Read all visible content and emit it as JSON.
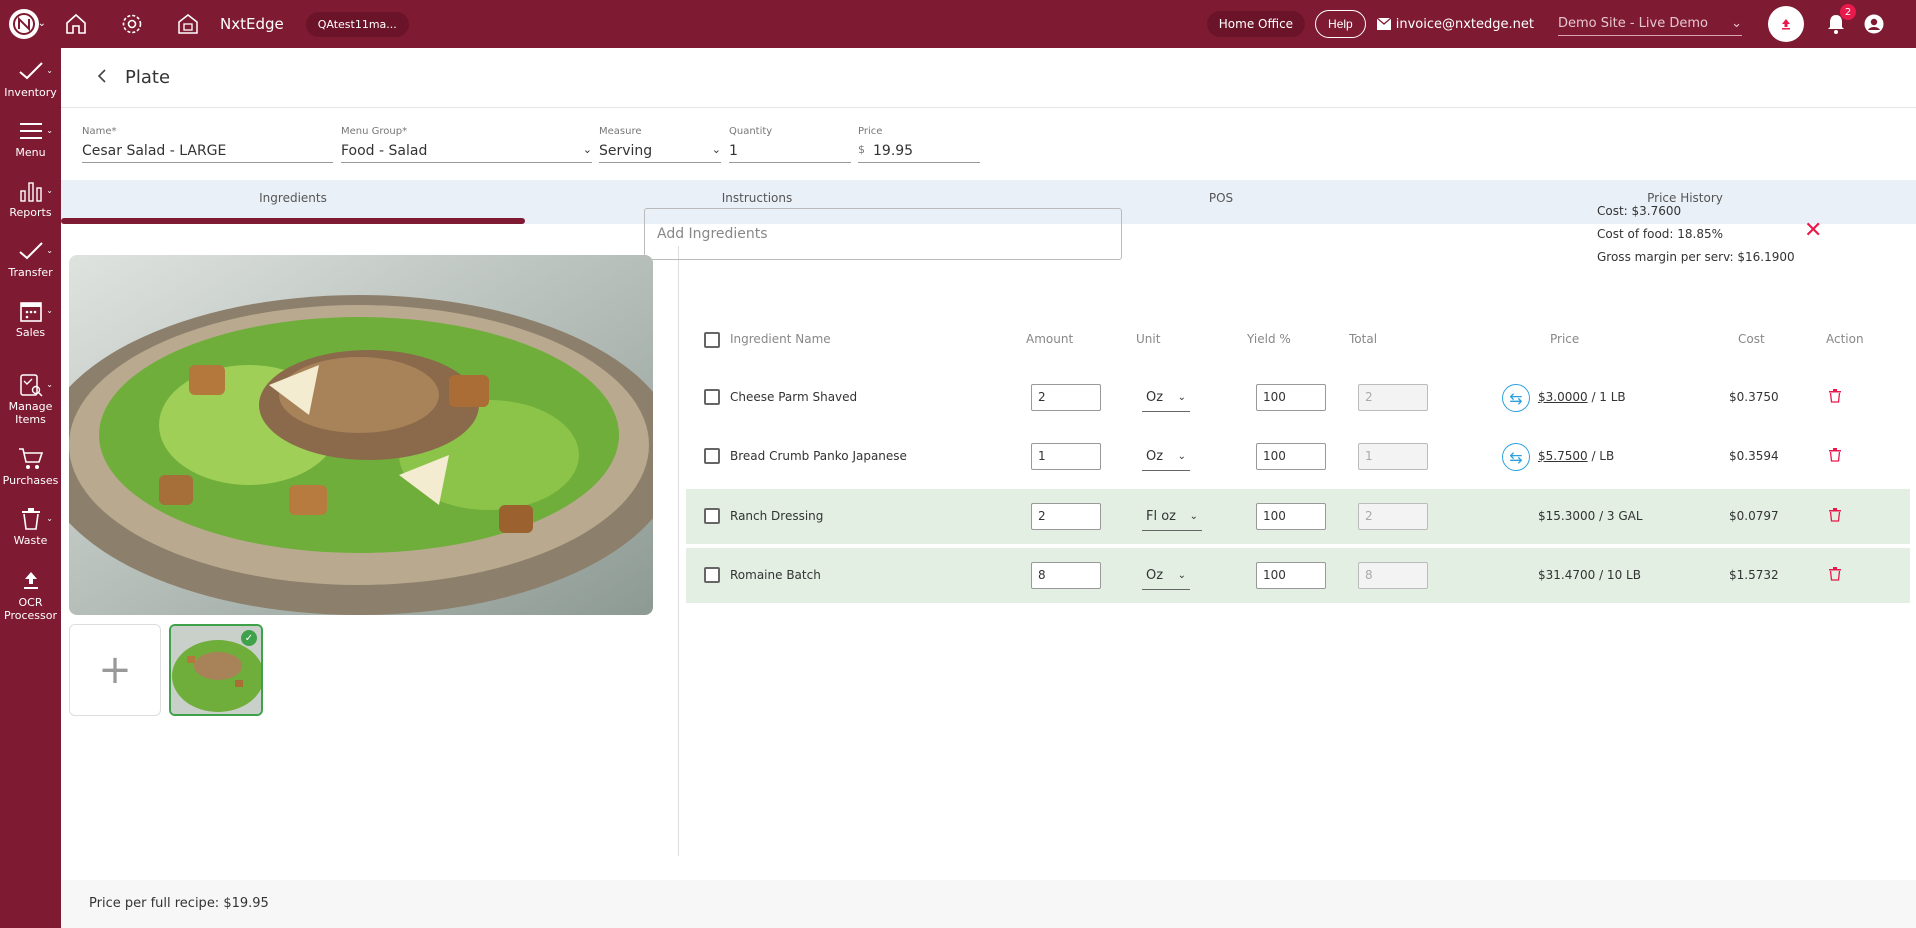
{
  "topbar": {
    "brand": "NxtEdge",
    "company_chip": "QAtest11ma...",
    "home_office": "Home Office",
    "help": "Help",
    "email": "invoice@nxtedge.net",
    "site": "Demo Site - Live Demo",
    "notifications": "2"
  },
  "sidebar": {
    "items": [
      {
        "label": "Inventory"
      },
      {
        "label": "Menu"
      },
      {
        "label": "Reports"
      },
      {
        "label": "Transfer"
      },
      {
        "label": "Sales"
      },
      {
        "label": "Manage Items"
      },
      {
        "label": "Purchases"
      },
      {
        "label": "Waste"
      },
      {
        "label": "OCR Processor"
      }
    ]
  },
  "page": {
    "title": "Plate"
  },
  "form": {
    "name_label": "Name*",
    "name": "Cesar Salad - LARGE",
    "menu_group_label": "Menu Group*",
    "menu_group": "Food - Salad",
    "measure_label": "Measure",
    "measure": "Serving",
    "quantity_label": "Quantity",
    "quantity": "1",
    "price_label": "Price",
    "price_currency": "$",
    "price": "19.95"
  },
  "tabs": [
    "Ingredients",
    "Instructions",
    "POS",
    "Price History"
  ],
  "ingredients": {
    "add_placeholder": "Add Ingredients",
    "summary": {
      "cost": "Cost: $3.7600",
      "cost_of_food": "Cost of food: 18.85%",
      "gross_margin": "Gross margin per serv: $16.1900"
    },
    "columns": [
      "Ingredient Name",
      "Amount",
      "Unit",
      "Yield %",
      "Total",
      "Price",
      "Cost",
      "Action"
    ],
    "rows": [
      {
        "name": "Cheese Parm Shaved",
        "amount": "2",
        "unit": "Oz",
        "yield": "100",
        "total": "2",
        "price_link": "$3.0000",
        "price_rest": " / 1 LB",
        "cost": "$0.3750"
      },
      {
        "name": "Bread Crumb Panko Japanese",
        "amount": "1",
        "unit": "Oz",
        "yield": "100",
        "total": "1",
        "price_link": "$5.7500",
        "price_rest": " / LB",
        "cost": "$0.3594"
      },
      {
        "name": "Ranch Dressing",
        "amount": "2",
        "unit": "Fl oz",
        "yield": "100",
        "total": "2",
        "price_link": "",
        "price_rest": "$15.3000 / 3 GAL",
        "cost": "$0.0797"
      },
      {
        "name": "Romaine Batch",
        "amount": "8",
        "unit": "Oz",
        "yield": "100",
        "total": "8",
        "price_link": "",
        "price_rest": "$31.4700 / 10 LB",
        "cost": "$1.5732"
      }
    ]
  },
  "footer": {
    "text": "Price per full recipe: $19.95"
  },
  "colors": {
    "brand": "#7e1b33",
    "accent_red": "#e8194b",
    "row_highlight": "#e3efe3",
    "swap_blue": "#2ea0de"
  }
}
